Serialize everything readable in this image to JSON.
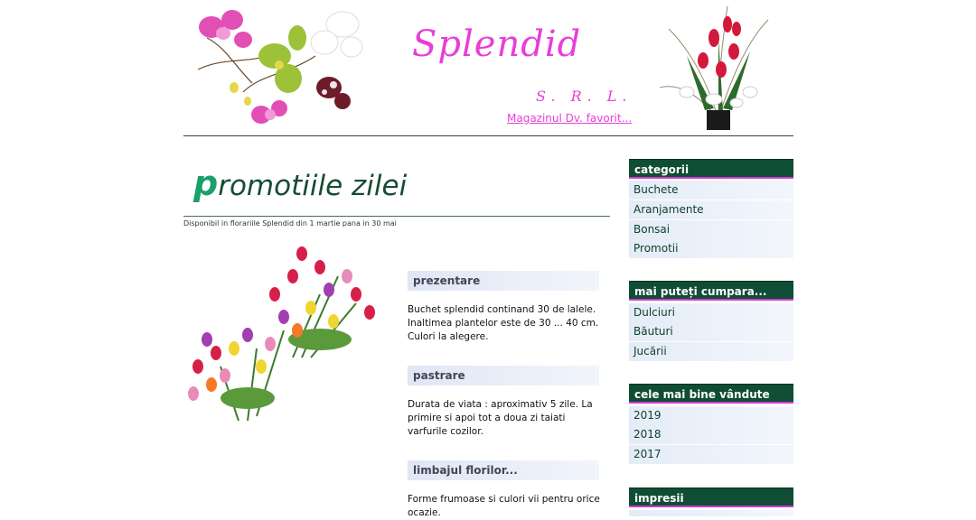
{
  "header": {
    "brand": "Splendid",
    "company_suffix": "S. R. L.",
    "tagline": "Magazinul Dv. favorit..."
  },
  "main": {
    "title_first_letter": "p",
    "title_rest": "romotiile zilei",
    "availability": "Disponibil in florariile Splendid din 1 martie pana in 30 mai",
    "sections": [
      {
        "heading": "prezentare",
        "text": "Buchet splendid continand 30 de lalele. Inaltimea plantelor este de 30 ... 40 cm. Culori la alegere."
      },
      {
        "heading": "pastrare",
        "text": "Durata de viata : aproximativ 5 zile. La primire si apoi tot a doua zi taiati varfurile cozilor."
      },
      {
        "heading": "limbajul florilor...",
        "text": "Forme frumoase si culori vii pentru orice ocazie."
      }
    ]
  },
  "sidebar": {
    "categories": {
      "heading": "categorii",
      "items": [
        "Buchete",
        "Aranjamente",
        "Bonsai",
        "Promotii"
      ]
    },
    "more": {
      "heading": "mai puteți cumpara...",
      "items": [
        "Dulciuri",
        "Băuturi",
        "Jucării"
      ]
    },
    "best": {
      "heading": "cele mai bine vândute",
      "items": [
        "2019",
        "2018",
        "2017"
      ]
    },
    "impressions": {
      "heading": "impresii"
    }
  },
  "colors": {
    "brand_pink": "#e83ed8",
    "sidebar_header": "#0f4d34",
    "title_green": "#174b34"
  }
}
